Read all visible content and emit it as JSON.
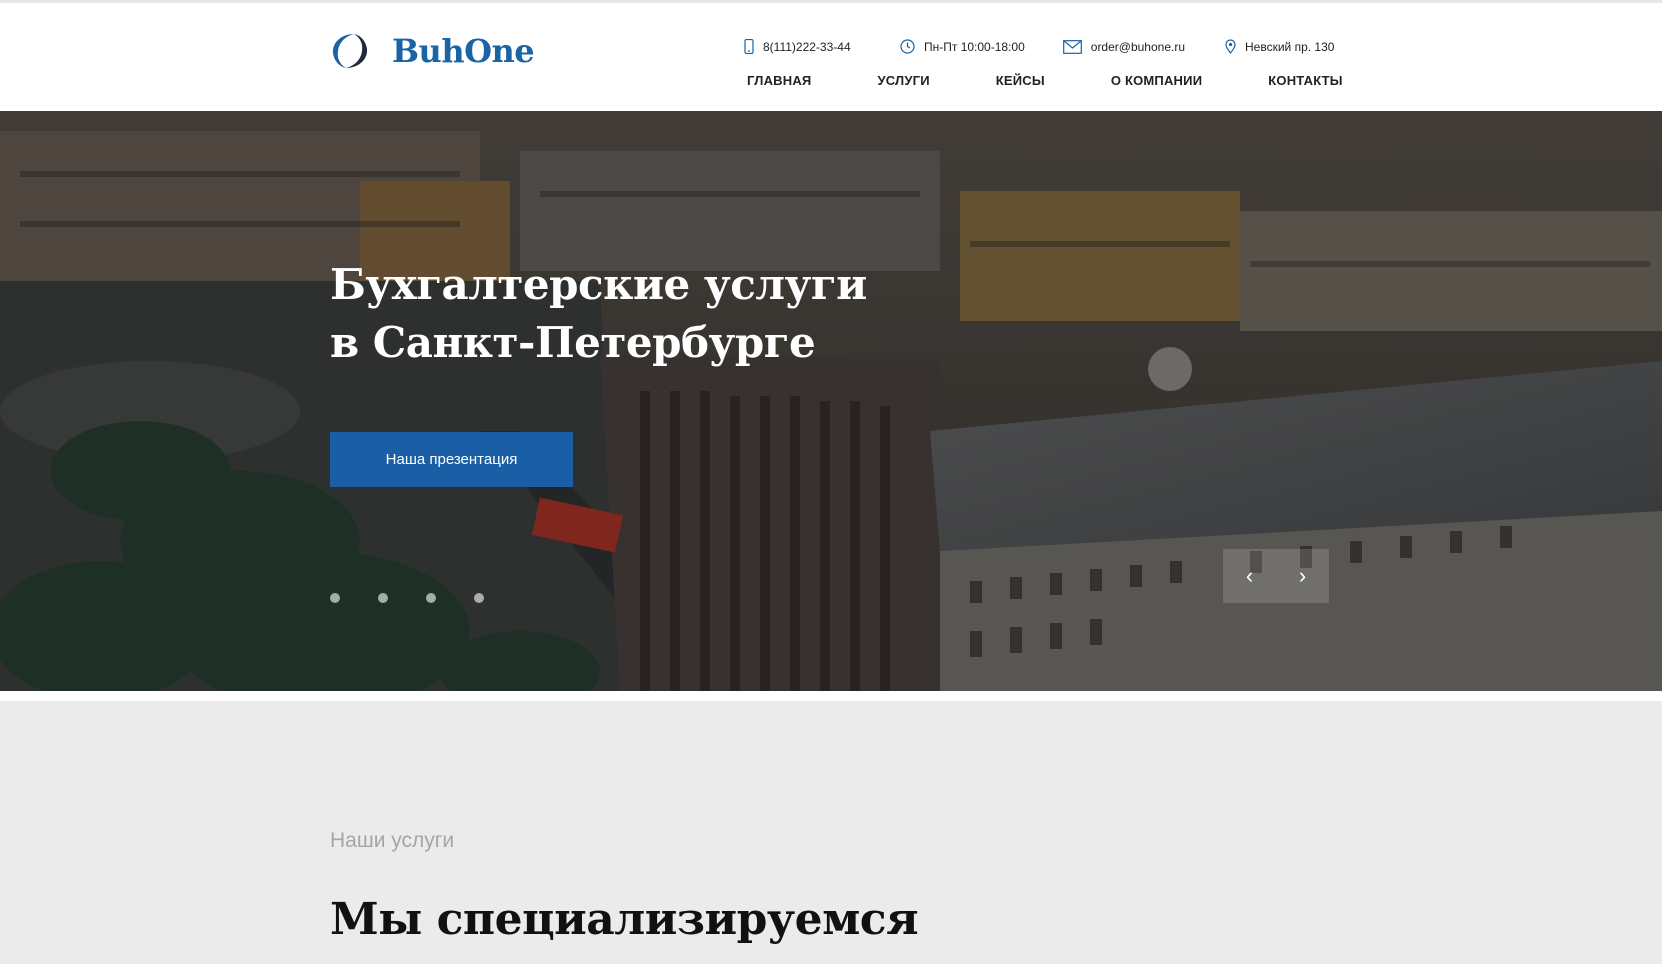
{
  "brand": {
    "name": "BuhOne",
    "color": "#1a63a5"
  },
  "contacts": {
    "phone": "8(111)222-33-44",
    "hours": "Пн-Пт 10:00-18:00",
    "email": "order@buhone.ru",
    "address": "Невский пр. 130"
  },
  "nav": [
    "ГЛАВНАЯ",
    "УСЛУГИ",
    "КЕЙСЫ",
    "О КОМПАНИИ",
    "КОНТАКТЫ"
  ],
  "hero": {
    "title_line1": "Бухгалтерские услуги",
    "title_line2": "в Санкт-Петербурге",
    "button": "Наша презентация",
    "button_color": "#1a5ea6",
    "slides_count": 4,
    "prev_icon": "‹",
    "next_icon": "›"
  },
  "services": {
    "label": "Наши услуги",
    "heading": "Мы специализируемся"
  }
}
